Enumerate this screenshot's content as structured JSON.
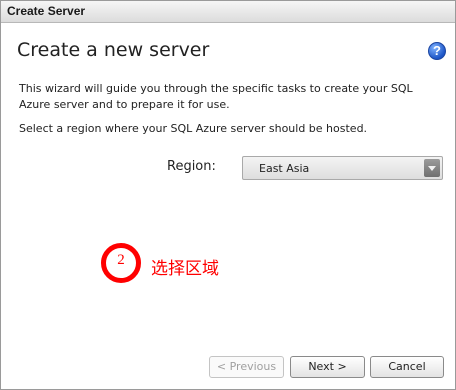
{
  "window": {
    "title": "Create Server"
  },
  "content": {
    "heading": "Create a new server",
    "help_glyph": "?",
    "description": "This wizard will guide you through the specific tasks to create your SQL Azure server and to prepare it for use.",
    "region_prompt": "Select a region where your SQL Azure server should be hosted."
  },
  "region": {
    "label": "Region:",
    "selected": "East Asia"
  },
  "annotation": {
    "step_number": "2",
    "text": "选择区域",
    "color": "#ff0000"
  },
  "footer": {
    "previous_label": "< Previous",
    "next_label": "Next >",
    "cancel_label": "Cancel"
  },
  "icons": {
    "help": "help-icon",
    "dropdown": "chevron-down-icon"
  }
}
